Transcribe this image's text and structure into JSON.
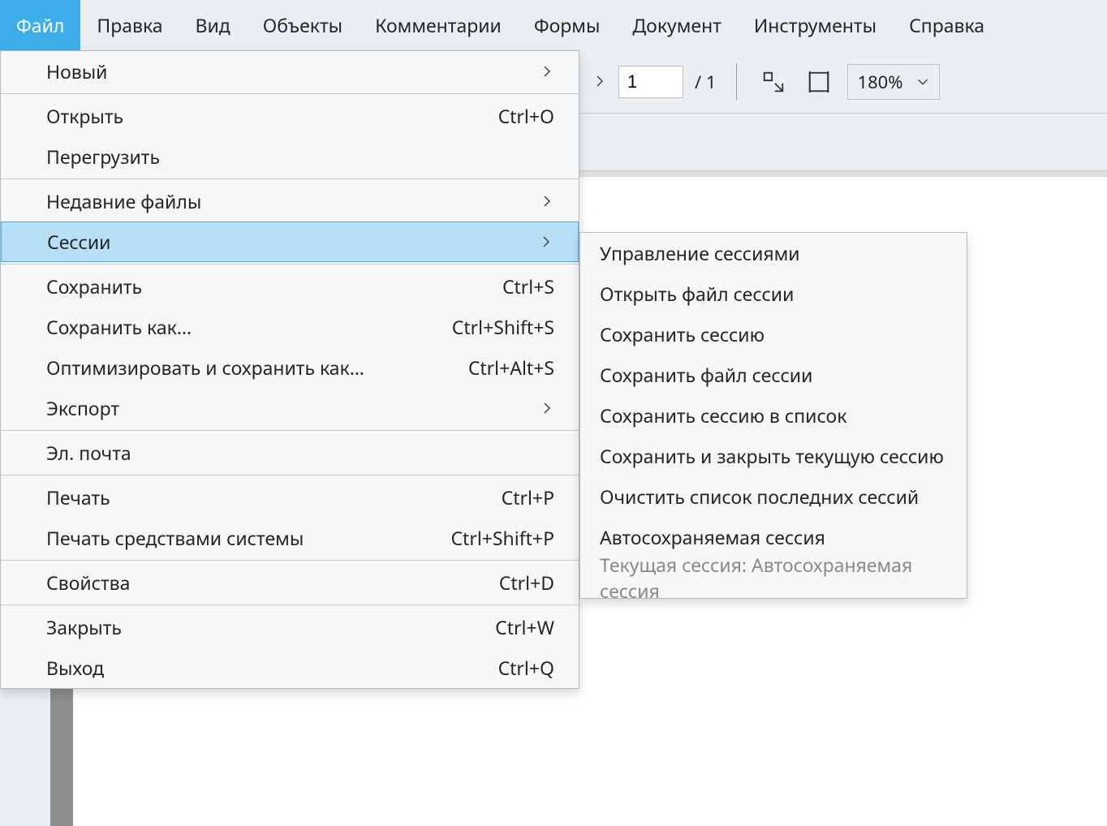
{
  "menubar": {
    "items": [
      "Файл",
      "Правка",
      "Вид",
      "Объекты",
      "Комментарии",
      "Формы",
      "Документ",
      "Инструменты",
      "Справка"
    ],
    "active_index": 0
  },
  "toolbar": {
    "page_current": "1",
    "page_total": "/ 1",
    "zoom": "180%"
  },
  "file_menu": {
    "new": "Новый",
    "open": {
      "label": "Открыть",
      "shortcut": "Ctrl+O"
    },
    "reload": "Перегрузить",
    "recent": "Недавние файлы",
    "sessions": "Сессии",
    "save": {
      "label": "Сохранить",
      "shortcut": "Ctrl+S"
    },
    "save_as": {
      "label": "Сохранить как…",
      "shortcut": "Ctrl+Shift+S"
    },
    "optimize_save_as": {
      "label": "Оптимизировать и сохранить как…",
      "shortcut": "Ctrl+Alt+S"
    },
    "export": "Экспорт",
    "email": "Эл. почта",
    "print": {
      "label": "Печать",
      "shortcut": "Ctrl+P"
    },
    "print_system": {
      "label": "Печать средствами системы",
      "shortcut": "Ctrl+Shift+P"
    },
    "properties": {
      "label": "Свойства",
      "shortcut": "Ctrl+D"
    },
    "close": {
      "label": "Закрыть",
      "shortcut": "Ctrl+W"
    },
    "quit": {
      "label": "Выход",
      "shortcut": "Ctrl+Q"
    }
  },
  "sessions_submenu": {
    "manage": "Управление сессиями",
    "open_file": "Открыть файл сессии",
    "save_session": "Сохранить сессию",
    "save_session_file": "Сохранить файл сессии",
    "save_to_list": "Сохранить сессию в список",
    "save_close_current": "Сохранить и закрыть текущую сессию",
    "clear_recent_list": "Очистить список последних сессий",
    "autosave": "Автосохраняемая сессия",
    "current_label": "Текущая сессия: Автосохраняемая сессия"
  }
}
